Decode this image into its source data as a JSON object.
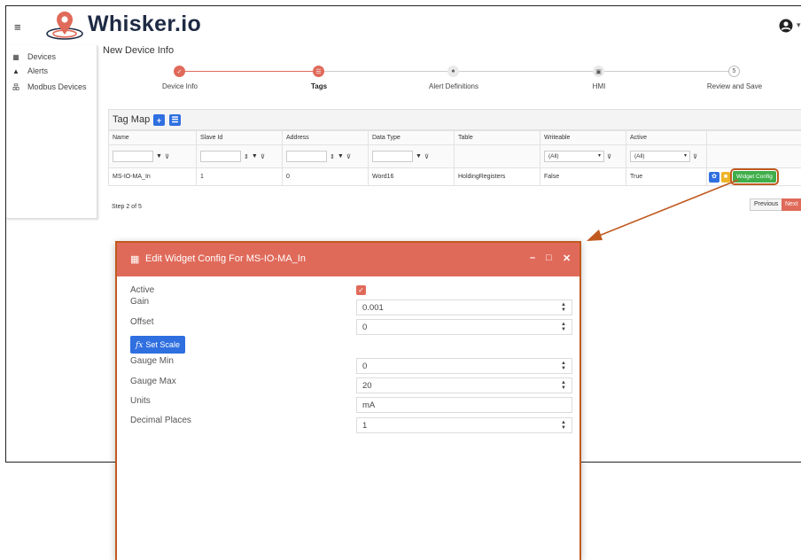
{
  "app": {
    "brand": "Whisker.io"
  },
  "header": {
    "menu_icon": "≡",
    "user_icon": "user-circle-icon"
  },
  "sidebar": {
    "items": [
      {
        "label": "Devices",
        "icon": "devices-icon"
      },
      {
        "label": "Alerts",
        "icon": "warning-icon"
      },
      {
        "label": "Modbus Devices",
        "icon": "network-icon"
      }
    ]
  },
  "page": {
    "title": "New Device Info"
  },
  "stepper": {
    "steps": [
      {
        "label": "Device Info",
        "marker": "✓"
      },
      {
        "label": "Tags",
        "marker": "☰"
      },
      {
        "label": "Alert Definitions",
        "marker": "♠"
      },
      {
        "label": "HMI",
        "marker": "▣"
      },
      {
        "label": "Review and Save",
        "marker": "5"
      }
    ],
    "active_index": 1
  },
  "grid": {
    "title": "Tag Map",
    "columns": [
      "Name",
      "Slave Id",
      "Address",
      "Data Type",
      "Table",
      "Writeable",
      "Active",
      ""
    ],
    "filters": {
      "writeable": "(All)",
      "active": "(All)"
    },
    "rows": [
      {
        "name": "MS-IO-MA_In",
        "slave_id": "1",
        "address": "0",
        "data_type": "Word16",
        "table": "HoldingRegisters",
        "writeable": "False",
        "active": "True"
      }
    ],
    "widget_button": "Widget Config",
    "footer": {
      "step_text": "Step 2 of 5",
      "previous": "Previous",
      "next": "Next"
    }
  },
  "dialog": {
    "title": "Edit Widget Config For MS-IO-MA_In",
    "controls": {
      "minimize": "–",
      "maximize": "□",
      "close": "✕"
    },
    "fields": {
      "active_label": "Active",
      "active_checked": true,
      "gain_label": "Gain",
      "gain_value": "0.001",
      "offset_label": "Offset",
      "offset_value": "0",
      "set_scale_fx": "fx",
      "set_scale_label": "Set Scale",
      "gauge_min_label": "Gauge Min",
      "gauge_min_value": "0",
      "gauge_max_label": "Gauge Max",
      "gauge_max_value": "20",
      "units_label": "Units",
      "units_value": "mA",
      "decimal_label": "Decimal Places",
      "decimal_value": "1"
    }
  },
  "colors": {
    "accent": "#e06a5a",
    "primary": "#2f6fe0",
    "success": "#3fae49",
    "warning": "#f0b429",
    "highlight": "#c05a1f"
  }
}
